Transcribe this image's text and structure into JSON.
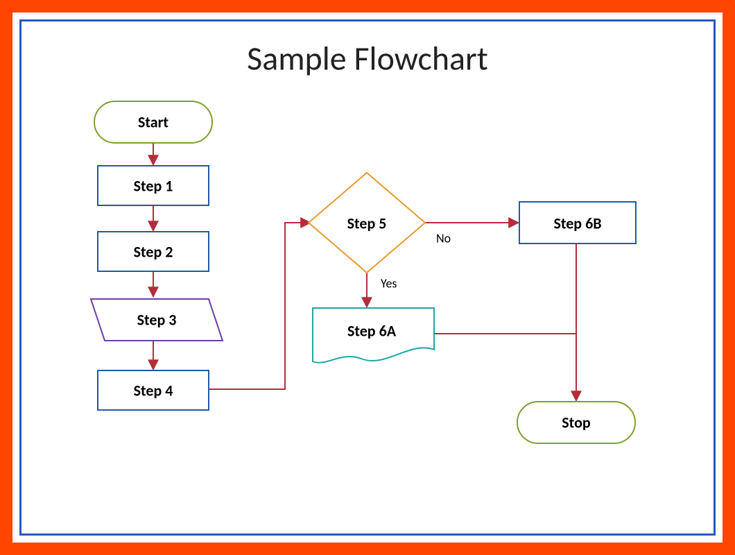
{
  "title": "Sample Flowchart",
  "nodes": {
    "start": {
      "label": "Start"
    },
    "step1": {
      "label": "Step 1"
    },
    "step2": {
      "label": "Step 2"
    },
    "step3": {
      "label": "Step 3"
    },
    "step4": {
      "label": "Step 4"
    },
    "step5": {
      "label": "Step 5"
    },
    "step6a": {
      "label": "Step 6A"
    },
    "step6b": {
      "label": "Step 6B"
    },
    "stop": {
      "label": "Stop"
    }
  },
  "edges": {
    "yes": "Yes",
    "no": "No"
  },
  "chart_data": {
    "type": "flowchart",
    "title": "Sample Flowchart",
    "nodes": [
      {
        "id": "start",
        "shape": "terminator",
        "label": "Start"
      },
      {
        "id": "step1",
        "shape": "process",
        "label": "Step 1"
      },
      {
        "id": "step2",
        "shape": "process",
        "label": "Step 2"
      },
      {
        "id": "step3",
        "shape": "data",
        "label": "Step 3"
      },
      {
        "id": "step4",
        "shape": "process",
        "label": "Step 4"
      },
      {
        "id": "step5",
        "shape": "decision",
        "label": "Step 5"
      },
      {
        "id": "step6a",
        "shape": "document",
        "label": "Step 6A"
      },
      {
        "id": "step6b",
        "shape": "process",
        "label": "Step 6B"
      },
      {
        "id": "stop",
        "shape": "terminator",
        "label": "Stop"
      }
    ],
    "edges": [
      {
        "from": "start",
        "to": "step1",
        "label": ""
      },
      {
        "from": "step1",
        "to": "step2",
        "label": ""
      },
      {
        "from": "step2",
        "to": "step3",
        "label": ""
      },
      {
        "from": "step3",
        "to": "step4",
        "label": ""
      },
      {
        "from": "step4",
        "to": "step5",
        "label": ""
      },
      {
        "from": "step5",
        "to": "step6a",
        "label": "Yes"
      },
      {
        "from": "step5",
        "to": "step6b",
        "label": "No"
      },
      {
        "from": "step6a",
        "to": "stop",
        "label": ""
      },
      {
        "from": "step6b",
        "to": "stop",
        "label": ""
      }
    ]
  }
}
